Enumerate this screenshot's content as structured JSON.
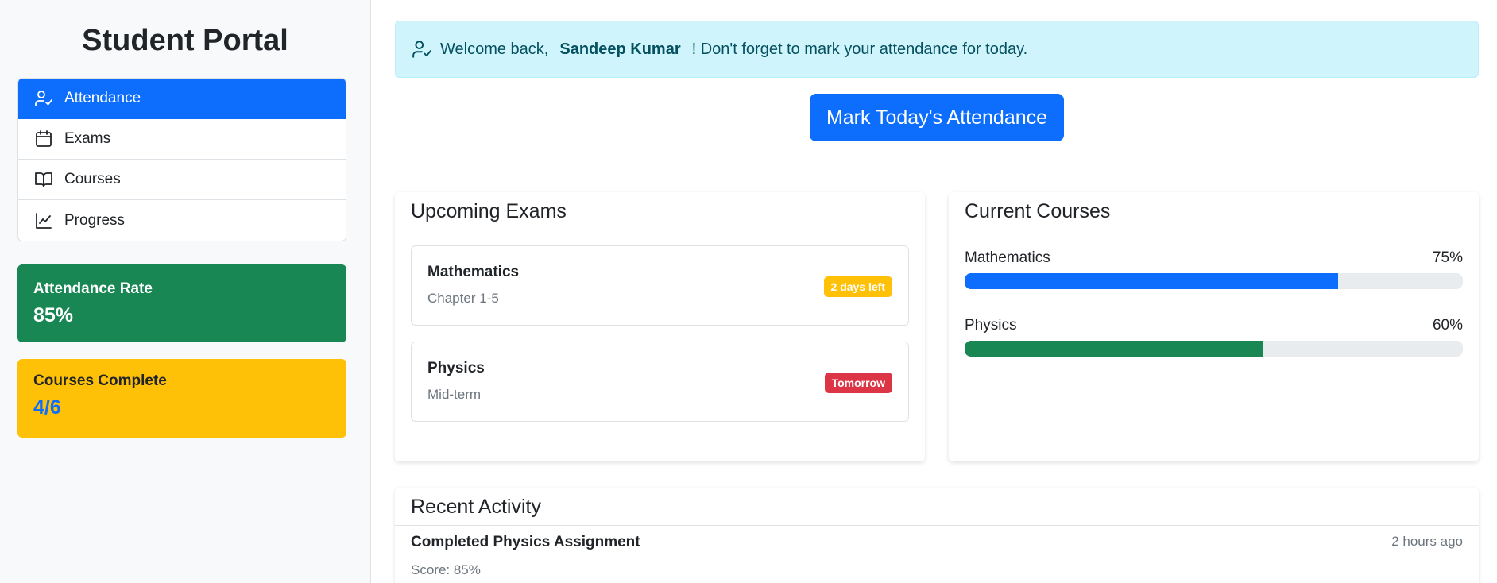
{
  "sidebar": {
    "title": "Student Portal",
    "nav": [
      {
        "label": "Attendance",
        "icon": "user-check-icon",
        "active": true
      },
      {
        "label": "Exams",
        "icon": "calendar-icon",
        "active": false
      },
      {
        "label": "Courses",
        "icon": "book-open-icon",
        "active": false
      },
      {
        "label": "Progress",
        "icon": "line-chart-icon",
        "active": false
      }
    ],
    "stats": {
      "attendance": {
        "label": "Attendance Rate",
        "value": "85%"
      },
      "courses": {
        "label": "Courses Complete",
        "value": "4/6"
      }
    }
  },
  "alert": {
    "prefix": "Welcome back,",
    "name": "Sandeep Kumar",
    "suffix": "! Don't forget to mark your attendance for today."
  },
  "mark_button": "Mark Today's Attendance",
  "exams": {
    "title": "Upcoming Exams",
    "items": [
      {
        "name": "Mathematics",
        "detail": "Chapter 1-5",
        "badge": "2 days left",
        "badge_color": "#ffc107"
      },
      {
        "name": "Physics",
        "detail": "Mid-term",
        "badge": "Tomorrow",
        "badge_color": "#dc3545"
      }
    ]
  },
  "courses": {
    "title": "Current Courses",
    "items": [
      {
        "name": "Mathematics",
        "percent_label": "75%",
        "progress": 0.75,
        "color": "#0d6efd"
      },
      {
        "name": "Physics",
        "percent_label": "60%",
        "progress": 0.6,
        "color": "#198754"
      }
    ]
  },
  "activity": {
    "title": "Recent Activity",
    "items": [
      {
        "title": "Completed Physics Assignment",
        "time": "2 hours ago",
        "detail": "Score: 85%"
      }
    ]
  },
  "colors": {
    "primary": "#0d6efd",
    "success": "#198754",
    "warning": "#ffc107",
    "danger": "#dc3545"
  }
}
